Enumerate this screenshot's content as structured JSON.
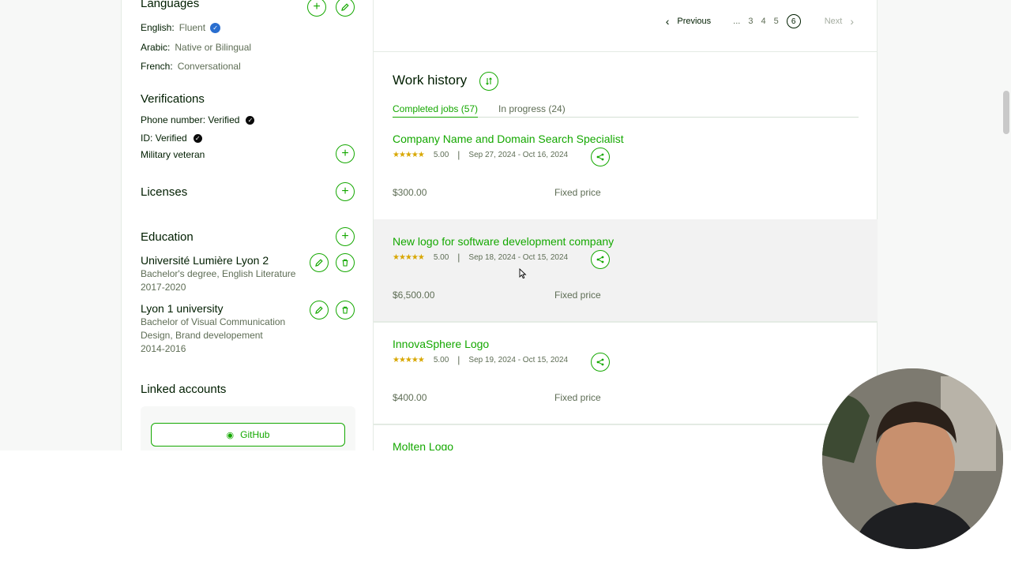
{
  "languages": {
    "title": "Languages",
    "items": [
      {
        "name": "English:",
        "level": "Fluent",
        "verified": true
      },
      {
        "name": "Arabic:",
        "level": "Native or Bilingual"
      },
      {
        "name": "French:",
        "level": "Conversational"
      }
    ]
  },
  "verifications": {
    "title": "Verifications",
    "items": [
      "Phone number: Verified",
      "ID: Verified",
      "Military veteran"
    ]
  },
  "licenses": {
    "title": "Licenses"
  },
  "education": {
    "title": "Education",
    "items": [
      {
        "school": "Université Lumière Lyon 2",
        "degree": "Bachelor's degree, English Literature",
        "years": "2017-2020"
      },
      {
        "school": "Lyon 1 university",
        "degree": "Bachelor of Visual Communication Design, Brand developement",
        "years": "2014-2016"
      }
    ]
  },
  "linked_accounts": {
    "title": "Linked accounts",
    "github_label": "GitHub"
  },
  "pagination": {
    "previous": "Previous",
    "ellipsis": "...",
    "pages": [
      "3",
      "4",
      "5"
    ],
    "current": "6",
    "next": "Next"
  },
  "work_history": {
    "title": "Work history",
    "tabs": [
      {
        "label": "Completed jobs (57)",
        "active": true
      },
      {
        "label": "In progress (24)",
        "active": false
      }
    ],
    "jobs": [
      {
        "title": "Company Name and Domain Search Specialist",
        "rating": "5.00",
        "dates": "Sep 27, 2024 - Oct 16, 2024",
        "amount": "$300.00",
        "type": "Fixed price"
      },
      {
        "title": "New logo for software development company",
        "rating": "5.00",
        "dates": "Sep 18, 2024 - Oct 15, 2024",
        "amount": "$6,500.00",
        "type": "Fixed price"
      },
      {
        "title": "InnovaSphere Logo",
        "rating": "5.00",
        "dates": "Sep 19, 2024 - Oct 15, 2024",
        "amount": "$400.00",
        "type": "Fixed price"
      },
      {
        "title": "Molten Logo"
      }
    ]
  },
  "colors": {
    "brand": "#14a800",
    "text": "#001e00",
    "muted": "#5e6d55",
    "star": "#d8a700"
  }
}
